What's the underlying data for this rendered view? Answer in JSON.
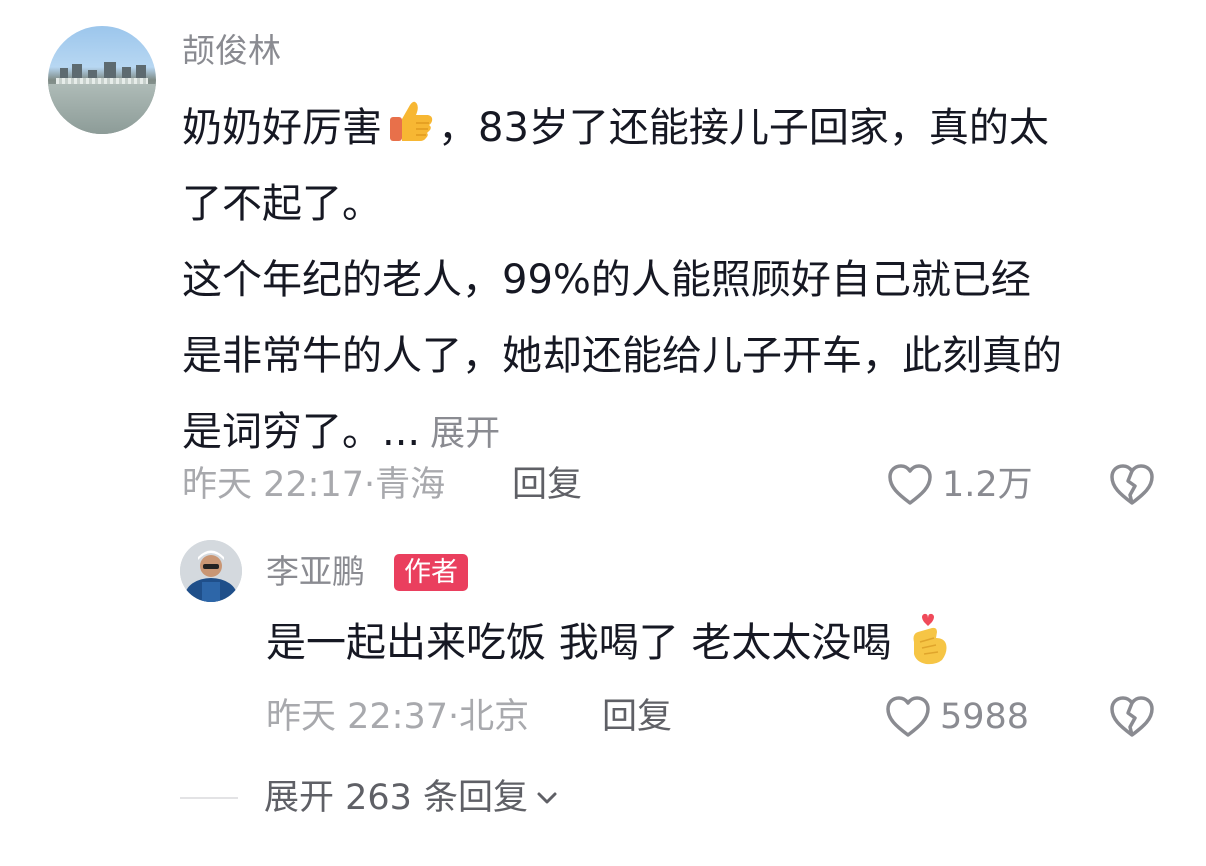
{
  "comment": {
    "author": "颉俊林",
    "text_lines": [
      {
        "before": "奶奶好厉害",
        "emoji": "thumbs-up",
        "after": "，83岁了还能接儿子回家，真的太"
      },
      {
        "text": "了不起了。"
      },
      {
        "text": "这个年纪的老人，99%的人能照顾好自己就已经"
      },
      {
        "text": "是非常牛的人了，她却还能给儿子开车，此刻真的"
      },
      {
        "text": "是词穷了。..."
      }
    ],
    "expand_label": "展开",
    "time_location": "昨天 22:17·青海",
    "reply_label": "回复",
    "like_count": "1.2万"
  },
  "reply": {
    "author": "李亚鹏",
    "badge": "作者",
    "text": "是一起出来吃饭 我喝了 老太太没喝",
    "emoji": "finger-heart",
    "time_location": "昨天 22:37·北京",
    "reply_label": "回复",
    "like_count": "5988"
  },
  "expand_replies_label": "展开 263 条回复",
  "colors": {
    "primary_text": "#161823",
    "secondary_text": "#8a8b91",
    "meta_text": "#a8a9ad",
    "badge_bg": "#ea3f5e"
  }
}
